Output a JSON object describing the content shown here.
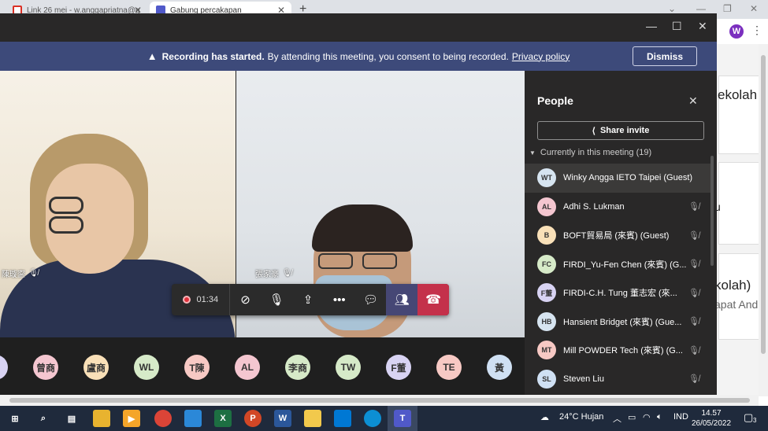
{
  "browser": {
    "tabs": [
      {
        "label": "Link 26 mei - w.anggapriatna@g"
      },
      {
        "label": "Gabung percakapan"
      }
    ],
    "profile_initial": "W"
  },
  "background_page": {
    "texts": [
      "ekolah",
      "u",
      "kolah)",
      "apat And"
    ]
  },
  "banner": {
    "bold": "Recording has started.",
    "message": "By attending this meeting, you consent to being recorded.",
    "link": "Privacy policy",
    "dismiss": "Dismiss"
  },
  "videos": [
    {
      "name": "陳璇寍"
    },
    {
      "name": "張家豪"
    }
  ],
  "controls": {
    "recording_time": "01:34"
  },
  "avatar_strip": [
    {
      "initials": "曾商",
      "color": "#f4c6d0"
    },
    {
      "initials": "盧商",
      "color": "#f9e0b8"
    },
    {
      "initials": "WL",
      "color": "#d6eac8"
    },
    {
      "initials": "T陳",
      "color": "#f7c9c4"
    },
    {
      "initials": "AL",
      "color": "#f4c6d0"
    },
    {
      "initials": "李商",
      "color": "#d6eac8"
    },
    {
      "initials": "TW",
      "color": "#d6eac8"
    },
    {
      "initials": "F董",
      "color": "#d8d3f3"
    },
    {
      "initials": "TE",
      "color": "#f7c9c4"
    },
    {
      "initials": "黃",
      "color": "#cfe0f3"
    }
  ],
  "people_panel": {
    "title": "People",
    "share_invite": "Share invite",
    "section_label": "Currently in this meeting (19)",
    "participants": [
      {
        "initials": "WT",
        "name": "Winky Angga IETO Taipei (Guest)",
        "color": "#d6e4f0"
      },
      {
        "initials": "AL",
        "name": "Adhi S. Lukman",
        "color": "#f4c6d0"
      },
      {
        "initials": "B",
        "name": "BOFT貿易局 (來賓) (Guest)",
        "color": "#f9e0b8"
      },
      {
        "initials": "FC",
        "name": "FIRDI_Yu-Fen Chen (來賓) (G...",
        "color": "#d6eac8"
      },
      {
        "initials": "F董",
        "name": "FIRDI-C.H. Tung 董志宏 (來...",
        "color": "#d8d3f3"
      },
      {
        "initials": "HB",
        "name": "Hansient Bridget (來賓) (Gue...",
        "color": "#d6e4f0"
      },
      {
        "initials": "MT",
        "name": "Mill POWDER Tech (來賓) (G...",
        "color": "#f7c9c4"
      },
      {
        "initials": "SL",
        "name": "Steven Liu",
        "color": "#cfe0f3"
      }
    ]
  },
  "taskbar": {
    "weather": "24°C  Hujan",
    "language": "IND",
    "time": "14.57",
    "date": "26/05/2022",
    "notifications": "3"
  }
}
